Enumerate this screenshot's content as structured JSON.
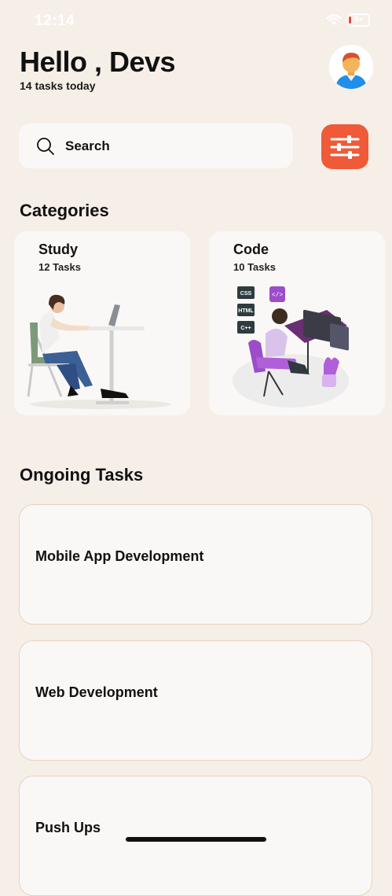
{
  "status_bar": {
    "time": "12:14",
    "battery": "9+"
  },
  "header": {
    "greeting": "Hello , Devs",
    "subtitle": "14 tasks today"
  },
  "search": {
    "placeholder": "Search"
  },
  "categories": {
    "title": "Categories",
    "items": [
      {
        "name": "Study",
        "count": "12 Tasks"
      },
      {
        "name": "Code",
        "count": "10 Tasks"
      }
    ]
  },
  "code_badges": [
    "CSS",
    "HTML",
    "C++"
  ],
  "ongoing": {
    "title": "Ongoing Tasks",
    "tasks": [
      {
        "label": "Mobile App Development"
      },
      {
        "label": "Web Development"
      },
      {
        "label": "Push Ups"
      }
    ]
  },
  "colors": {
    "background": "#f6efe8",
    "card": "#faf8f6",
    "accent": "#ef5a39",
    "task_border": "#e6d2bd",
    "code_purple": "#9b4dca"
  },
  "icons": [
    "wifi-icon",
    "battery-icon",
    "avatar-icon",
    "search-icon",
    "filter-sliders-icon"
  ]
}
